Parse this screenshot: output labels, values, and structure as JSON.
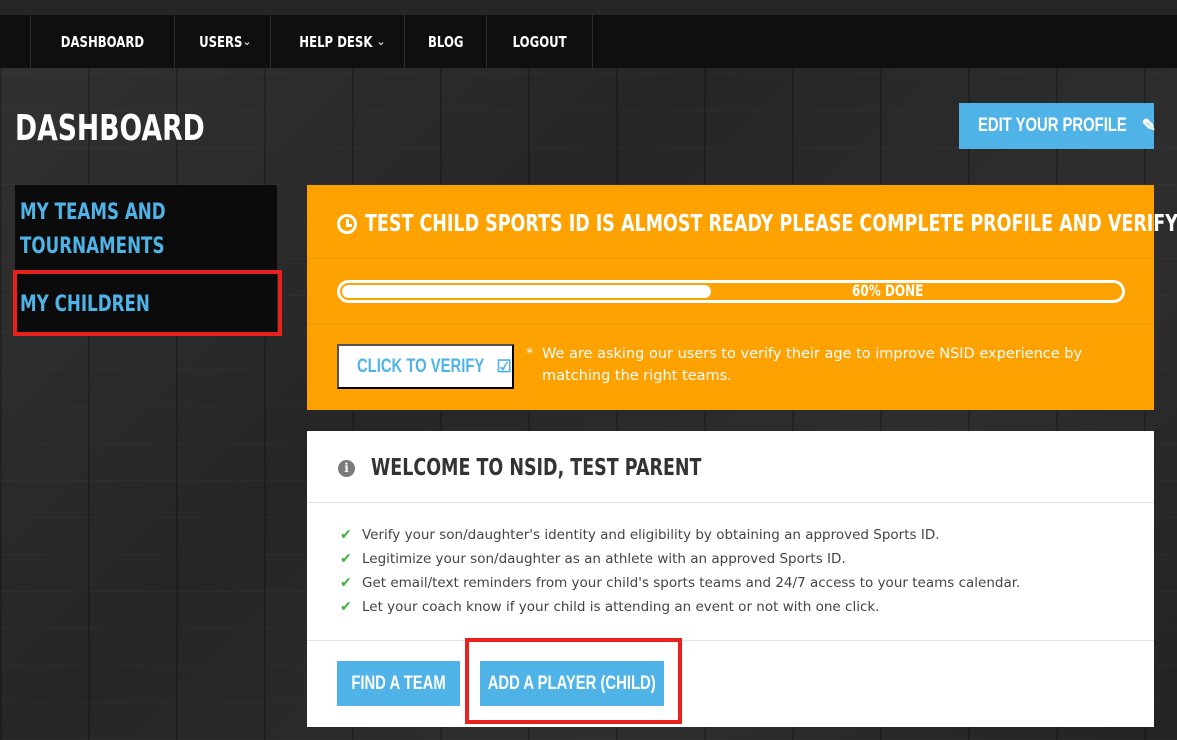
{
  "nav": {
    "items": [
      {
        "label": "DASHBOARD",
        "has_dropdown": false
      },
      {
        "label": "USERS",
        "has_dropdown": true
      },
      {
        "label": "HELP DESK",
        "has_dropdown": true
      },
      {
        "label": "BLOG",
        "has_dropdown": false
      },
      {
        "label": "LOGOUT",
        "has_dropdown": false
      }
    ]
  },
  "page": {
    "title": "DASHBOARD",
    "edit_profile_label": "EDIT YOUR PROFILE"
  },
  "sidebar": {
    "items": [
      {
        "label": "MY TEAMS AND TOURNAMENTS",
        "line1": "MY TEAMS AND",
        "line2": "TOURNAMENTS"
      },
      {
        "label": "MY CHILDREN",
        "highlighted": true
      }
    ]
  },
  "alert": {
    "title": "TEST CHILD SPORTS ID IS ALMOST READY PLEASE COMPLETE PROFILE AND VERIFY AGE.",
    "progress_percent": 60,
    "progress_label": "60% DONE",
    "verify_label": "CLICK TO VERIFY",
    "note_asterisk": "*",
    "note": "We are asking our users to verify their age to improve NSID experience by matching the right teams."
  },
  "welcome": {
    "title": "WELCOME TO NSID, TEST PARENT",
    "features": [
      "Verify your son/daughter's identity and eligibility by obtaining an approved Sports ID.",
      "Legitimize your son/daughter as an athlete with an approved Sports ID.",
      "Get email/text reminders from your child's sports teams and 24/7 access to your teams calendar.",
      "Let your coach know if your child is attending an event or not with one click."
    ],
    "find_team_label": "FIND A TEAM",
    "add_player_label": "ADD A PLAYER (CHILD)"
  },
  "colors": {
    "accent_blue": "#4fb3e8",
    "alert_orange": "#fea201",
    "highlight_red": "#e8211c",
    "check_green": "#44b244",
    "nav_bg": "#0f0f0f"
  },
  "icons": {
    "clock": "clock-icon",
    "edit": "edit-icon",
    "check_square": "check-square-icon",
    "info": "info-icon",
    "check": "check-icon",
    "chevron": "chevron-down-icon"
  }
}
